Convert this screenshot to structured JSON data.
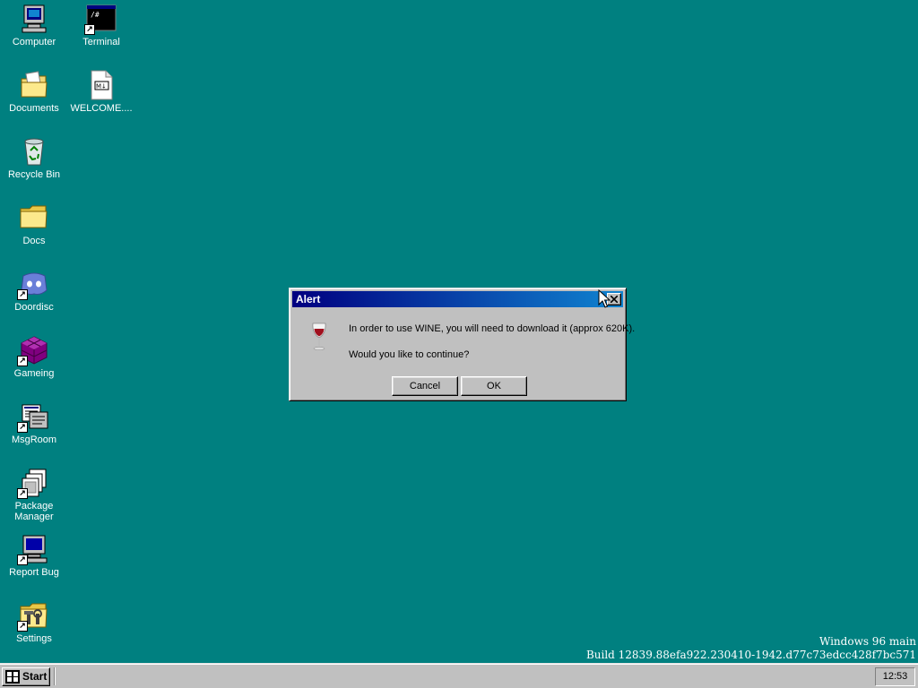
{
  "desktop": {
    "background_color": "#008080",
    "icons": [
      {
        "label": "Computer",
        "icon": "computer-icon"
      },
      {
        "label": "Terminal",
        "icon": "terminal-icon"
      },
      {
        "label": "Documents",
        "icon": "documents-folder-icon"
      },
      {
        "label": "WELCOME....",
        "icon": "markdown-file-icon"
      },
      {
        "label": "Recycle Bin",
        "icon": "recycle-bin-icon"
      },
      {
        "label": "Docs",
        "icon": "folder-icon"
      },
      {
        "label": "Doordisc",
        "icon": "doordisc-icon"
      },
      {
        "label": "Gameing",
        "icon": "gameing-icon"
      },
      {
        "label": "MsgRoom",
        "icon": "msgroom-icon"
      },
      {
        "label": "Package Manager",
        "icon": "package-manager-icon"
      },
      {
        "label": "Report Bug",
        "icon": "report-bug-icon"
      },
      {
        "label": "Settings",
        "icon": "settings-icon"
      }
    ]
  },
  "dialog": {
    "title": "Alert",
    "message": "In order to use WINE, you will need to download it (approx 620K).",
    "question": "Would you like to continue?",
    "cancel_label": "Cancel",
    "ok_label": "OK",
    "icon": "wine-glass-icon"
  },
  "watermark": {
    "line1": "Windows 96 main",
    "line2": "Build 12839.88efa922.230410-1942.d77c73edcc428f7bc571"
  },
  "taskbar": {
    "start_label": "Start",
    "clock": "12:53"
  }
}
